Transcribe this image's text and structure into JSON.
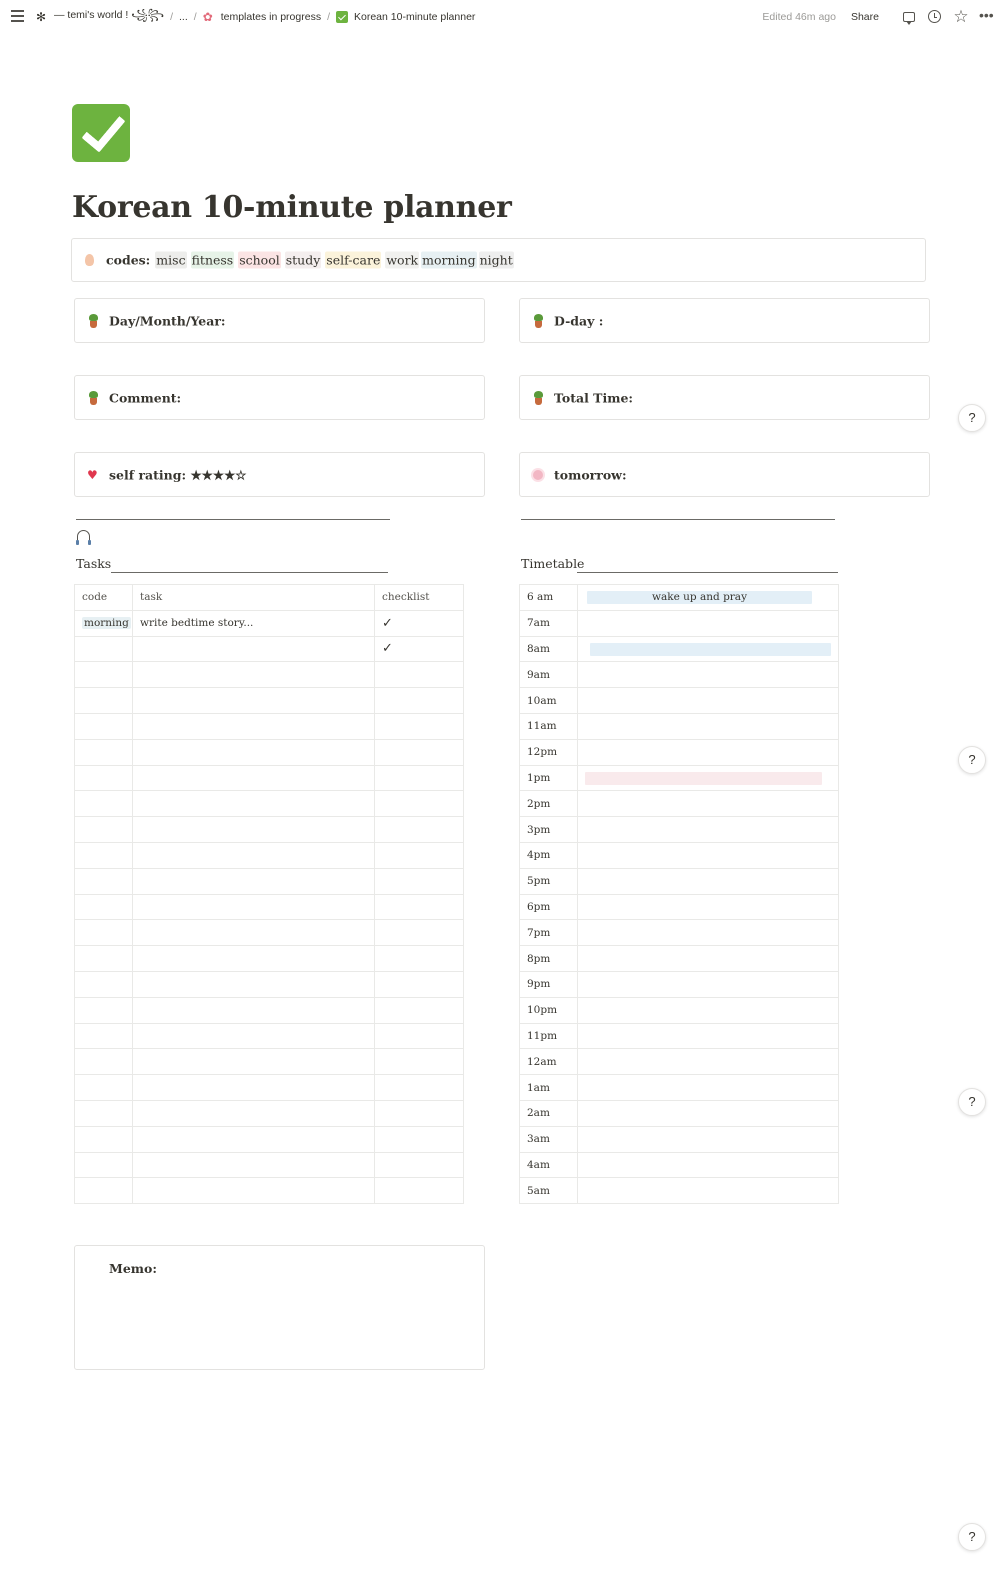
{
  "topbar": {
    "breadcrumbs": [
      {
        "label": "— temi's world ! ꧁꧂",
        "icon": "ribbon-icon"
      },
      {
        "label": "..."
      },
      {
        "label": "templates in progress",
        "icon": "flower-icon"
      },
      {
        "label": "Korean 10-minute planner",
        "icon": "check-icon"
      }
    ],
    "edited": "Edited 46m ago",
    "share": "Share"
  },
  "page": {
    "title": "Korean 10-minute planner",
    "icon": "check-mark-button-icon",
    "accent": "#6db33f"
  },
  "codes": {
    "label": "codes:",
    "tags": [
      {
        "text": "misc",
        "bg": "#ededeb"
      },
      {
        "text": "fitness",
        "bg": "#e7f3e8"
      },
      {
        "text": "school",
        "bg": "#fbe4e4"
      },
      {
        "text": "study",
        "bg": "#f4eeee"
      },
      {
        "text": "self-care",
        "bg": "#fbf3db"
      },
      {
        "text": "work",
        "bg": "#f1f1ef"
      },
      {
        "text": "morning",
        "bg": "#e7f0f3"
      },
      {
        "text": "night",
        "bg": "#eeeeee"
      }
    ]
  },
  "fields": {
    "day_month_year": "Day/Month/Year:",
    "d_day": "D-day :",
    "comment": "Comment:",
    "total_time": "Total Time:",
    "self_rating": "self rating: ★★★★☆",
    "tomorrow": "tomorrow:",
    "memo": "Memo:"
  },
  "tasks": {
    "title": "Tasks",
    "columns": [
      "code",
      "task",
      "checklist"
    ],
    "rows": [
      {
        "code": "morning",
        "task": "write bedtime story...",
        "check": "✓"
      },
      {
        "code": "",
        "task": "",
        "check": "✓"
      },
      {
        "code": "",
        "task": "",
        "check": ""
      },
      {
        "code": "",
        "task": "",
        "check": ""
      },
      {
        "code": "",
        "task": "",
        "check": ""
      },
      {
        "code": "",
        "task": "",
        "check": ""
      },
      {
        "code": "",
        "task": "",
        "check": ""
      },
      {
        "code": "",
        "task": "",
        "check": ""
      },
      {
        "code": "",
        "task": "",
        "check": ""
      },
      {
        "code": "",
        "task": "",
        "check": ""
      },
      {
        "code": "",
        "task": "",
        "check": ""
      },
      {
        "code": "",
        "task": "",
        "check": ""
      },
      {
        "code": "",
        "task": "",
        "check": ""
      },
      {
        "code": "",
        "task": "",
        "check": ""
      },
      {
        "code": "",
        "task": "",
        "check": ""
      },
      {
        "code": "",
        "task": "",
        "check": ""
      },
      {
        "code": "",
        "task": "",
        "check": ""
      },
      {
        "code": "",
        "task": "",
        "check": ""
      },
      {
        "code": "",
        "task": "",
        "check": ""
      },
      {
        "code": "",
        "task": "",
        "check": ""
      },
      {
        "code": "",
        "task": "",
        "check": ""
      },
      {
        "code": "",
        "task": "",
        "check": ""
      },
      {
        "code": "",
        "task": "",
        "check": ""
      }
    ]
  },
  "timetable": {
    "title": "Timetable",
    "rows": [
      {
        "time": "6 am",
        "bar": "wake up and pray",
        "bar_color": "#e3eff7"
      },
      {
        "time": "7am"
      },
      {
        "time": "8am",
        "bar": "",
        "bar_color": "#e3eff7"
      },
      {
        "time": "9am"
      },
      {
        "time": "10am"
      },
      {
        "time": "11am"
      },
      {
        "time": "12pm"
      },
      {
        "time": "1pm",
        "bar": "",
        "bar_color": "#f9eaec"
      },
      {
        "time": "2pm"
      },
      {
        "time": "3pm"
      },
      {
        "time": "4pm"
      },
      {
        "time": "5pm"
      },
      {
        "time": "6pm"
      },
      {
        "time": "7pm"
      },
      {
        "time": "8pm"
      },
      {
        "time": "9pm"
      },
      {
        "time": "10pm"
      },
      {
        "time": "11pm"
      },
      {
        "time": "12am"
      },
      {
        "time": "1am"
      },
      {
        "time": "2am"
      },
      {
        "time": "3am"
      },
      {
        "time": "4am"
      },
      {
        "time": "5am"
      }
    ]
  },
  "help": "?"
}
